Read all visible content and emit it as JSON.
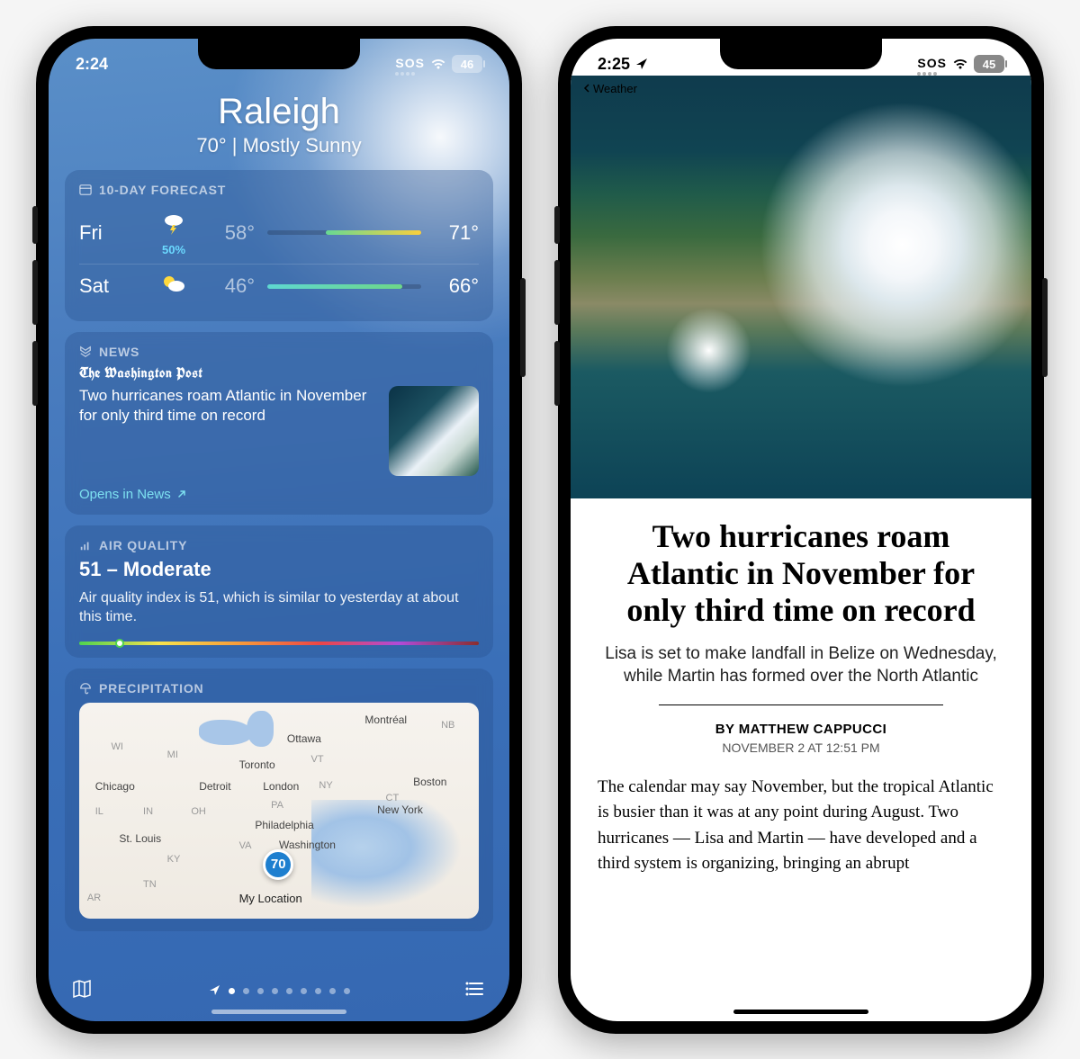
{
  "left": {
    "status": {
      "time": "2:24",
      "sos": "SOS",
      "battery": "46"
    },
    "hero": {
      "city": "Raleigh",
      "summary": "70°  |  Mostly Sunny"
    },
    "forecast": {
      "header": "10-DAY FORECAST",
      "rows": [
        {
          "day": "Fri",
          "chance": "50%",
          "lo": "58°",
          "hi": "71°"
        },
        {
          "day": "Sat",
          "chance": "",
          "lo": "46°",
          "hi": "66°"
        }
      ]
    },
    "news": {
      "header": "NEWS",
      "source": "The Washington Post",
      "headline": "Two hurricanes roam Atlantic in November for only third time on record",
      "link": "Opens in News"
    },
    "aqi": {
      "header": "AIR QUALITY",
      "value": "51 – Moderate",
      "desc": "Air quality index is 51, which is similar to yesterday at about this time."
    },
    "precip": {
      "header": "PRECIPITATION",
      "pin": "70",
      "pin_label": "My Location",
      "cities": {
        "montreal": "Montréal",
        "ottawa": "Ottawa",
        "toronto": "Toronto",
        "chicago": "Chicago",
        "detroit": "Detroit",
        "london": "London",
        "boston": "Boston",
        "newyork": "New York",
        "philadelphia": "Philadelphia",
        "washington": "Washington",
        "stlouis": "St. Louis"
      },
      "states": {
        "wi": "WI",
        "mi": "MI",
        "il": "IL",
        "in": "IN",
        "oh": "OH",
        "pa": "PA",
        "ny": "NY",
        "vt": "VT",
        "ct": "CT",
        "nb": "NB",
        "va": "VA",
        "ky": "KY",
        "tn": "TN",
        "ar": "AR"
      }
    }
  },
  "right": {
    "status": {
      "time": "2:25",
      "sos": "SOS",
      "battery": "45"
    },
    "back": "Weather",
    "headline": "Two hurricanes roam Atlantic in November for only third time on record",
    "subhead": "Lisa is set to make landfall in Belize on Wednesday, while Martin has formed over the North Atlantic",
    "byline": "BY MATTHEW CAPPUCCI",
    "pubdate": "NOVEMBER 2 AT 12:51 PM",
    "body": "The calendar may say November, but the tropical Atlantic is busier than it was at any point during August. Two hurricanes — Lisa and Martin — have developed and a third system is organizing, bringing an abrupt"
  }
}
